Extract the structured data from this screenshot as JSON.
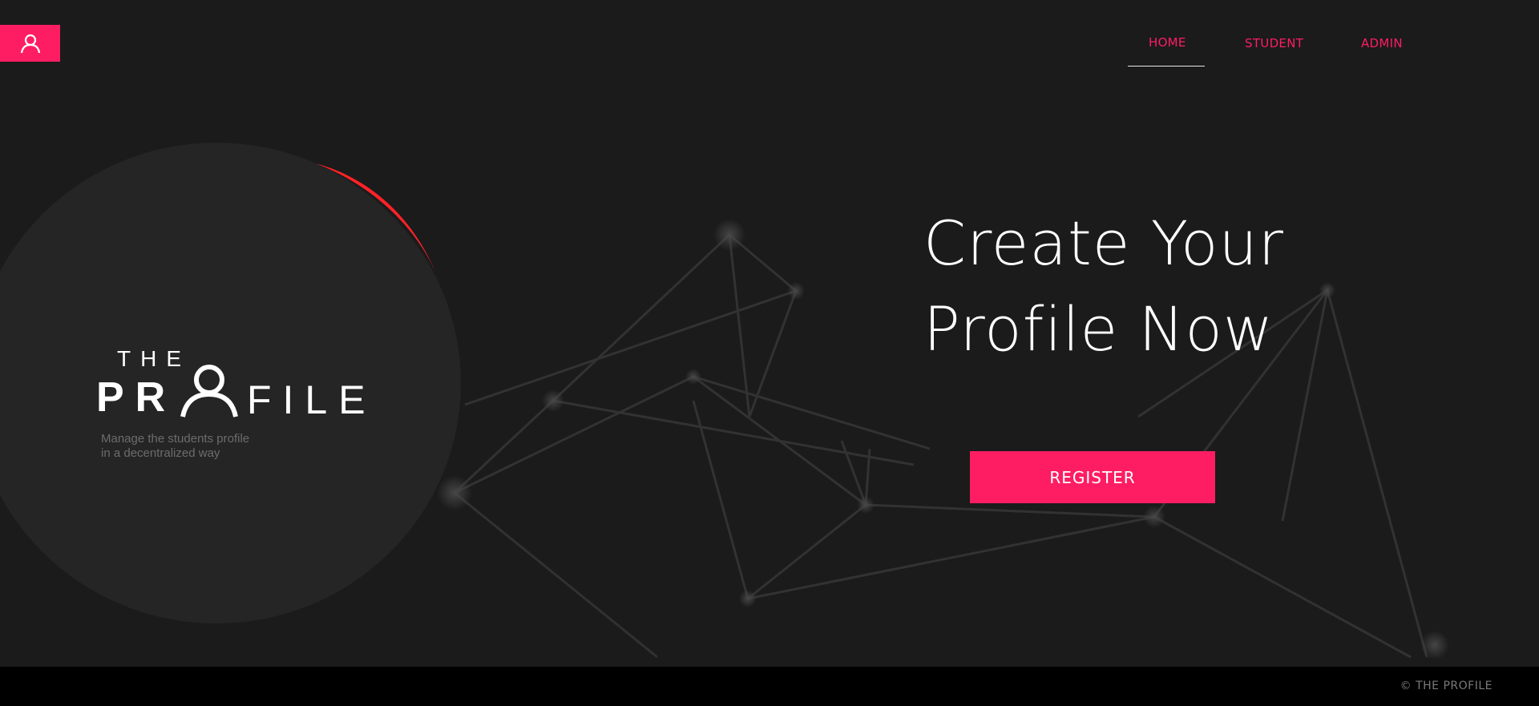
{
  "header": {
    "user_icon": "user-icon",
    "nav": [
      {
        "label": "HOME",
        "active": true
      },
      {
        "label": "STUDENT",
        "active": false
      },
      {
        "label": "ADMIN",
        "active": false
      }
    ]
  },
  "brand": {
    "logo_top": "THE",
    "logo_left": "PR",
    "logo_right": "FILE",
    "tagline_line1": "Manage the students profile",
    "tagline_line2": "in a decentralized way"
  },
  "hero": {
    "title_line1": "Create Your",
    "title_line2": "Profile Now",
    "register_label": "REGISTER"
  },
  "footer": {
    "copyright": "© THE PROFILE"
  },
  "colors": {
    "accent": "#fe1d63",
    "crescent": "#ff2226",
    "background": "#1b1b1c",
    "circle": "#252526",
    "footer": "#000000"
  }
}
